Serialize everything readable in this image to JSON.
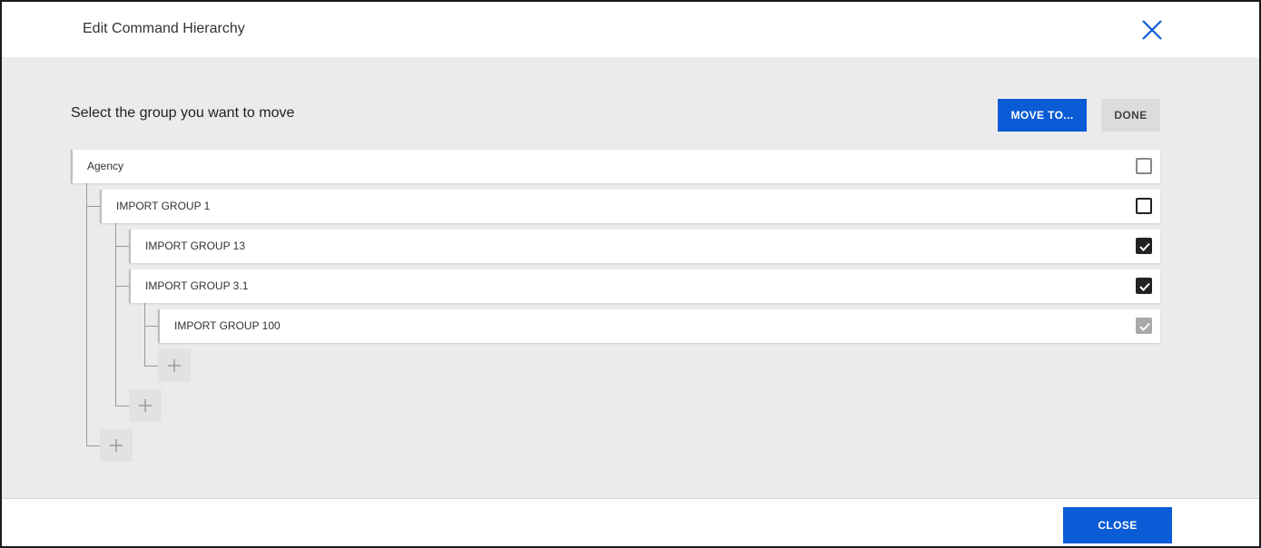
{
  "dialog": {
    "title": "Edit Command Hierarchy"
  },
  "toolbar": {
    "instruction": "Select the group you want to move",
    "move_label": "MOVE TO...",
    "done_label": "DONE"
  },
  "tree": {
    "nodes": [
      {
        "label": "Agency",
        "level": 0,
        "checked": false,
        "disabled": false
      },
      {
        "label": "IMPORT GROUP 1",
        "level": 1,
        "checked": false,
        "disabled": false
      },
      {
        "label": "IMPORT GROUP 13",
        "level": 2,
        "checked": true,
        "disabled": false
      },
      {
        "label": "IMPORT GROUP 3.1",
        "level": 2,
        "checked": true,
        "disabled": false
      },
      {
        "label": "IMPORT GROUP 100",
        "level": 3,
        "checked": true,
        "disabled": true
      }
    ]
  },
  "footer": {
    "close_label": "CLOSE"
  },
  "colors": {
    "primary": "#0a5bd6",
    "body_bg": "#ebebeb",
    "secondary_btn": "#dcdcdc"
  },
  "icons": {
    "close": "close-x-icon",
    "add": "plus-icon",
    "check": "checkmark-icon"
  }
}
